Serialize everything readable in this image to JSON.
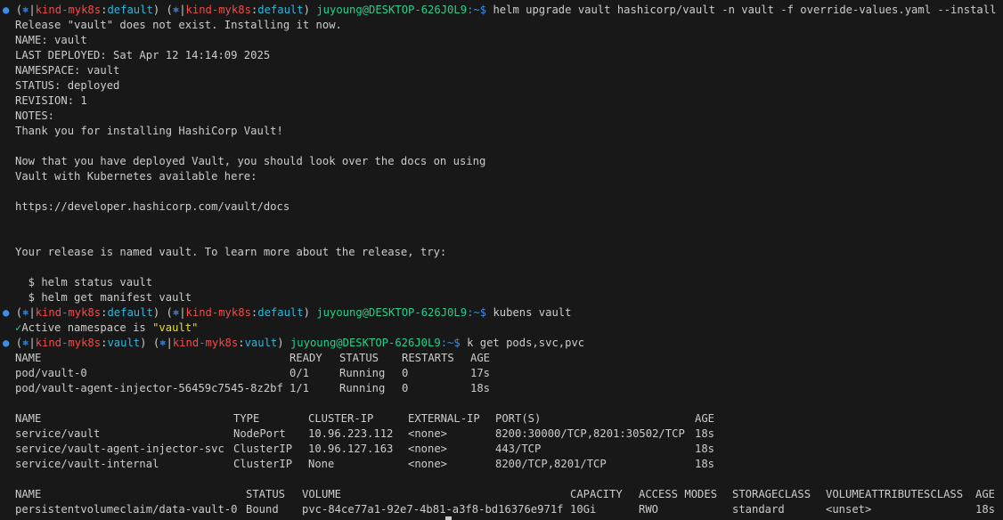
{
  "theme": {
    "background": "#181818",
    "text": "#cccccc",
    "red": "#f14c4c",
    "green": "#23d18b",
    "blue": "#3b8eea",
    "cyan": "#29b8db",
    "yellow": "#e5e510"
  },
  "prompts": [
    {
      "bullet": "●",
      "open": "(",
      "k8s_icon": "⎈",
      "sep": "|",
      "context": "kind-myk8s",
      "colon": ":",
      "namespace": "default",
      "close": ")",
      "user_host": "juyoung@DESKTOP-626J0L9",
      "dollar": ":~$",
      "command": "helm upgrade vault hashicorp/vault -n vault -f override-values.yaml --install"
    },
    {
      "bullet": "●",
      "open": "(",
      "k8s_icon": "⎈",
      "sep": "|",
      "context": "kind-myk8s",
      "colon": ":",
      "namespace": "default",
      "close": ")",
      "user_host": "juyoung@DESKTOP-626J0L9",
      "dollar": ":~$",
      "command": "kubens vault"
    },
    {
      "bullet": "●",
      "open": "(",
      "k8s_icon": "⎈",
      "sep": "|",
      "context": "kind-myk8s",
      "colon": ":",
      "namespace": "vault",
      "close": ")",
      "user_host": "juyoung@DESKTOP-626J0L9",
      "dollar": ":~$",
      "command": "k get pods,svc,pvc"
    }
  ],
  "helm_output": [
    "Release \"vault\" does not exist. Installing it now.",
    "NAME: vault",
    "LAST DEPLOYED: Sat Apr 12 14:14:09 2025",
    "NAMESPACE: vault",
    "STATUS: deployed",
    "REVISION: 1",
    "NOTES:",
    "Thank you for installing HashiCorp Vault!",
    "",
    "Now that you have deployed Vault, you should look over the docs on using",
    "Vault with Kubernetes available here:",
    "",
    "https://developer.hashicorp.com/vault/docs",
    "",
    "",
    "Your release is named vault. To learn more about the release, try:",
    "",
    "  $ helm status vault",
    "  $ helm get manifest vault"
  ],
  "kubens_output": {
    "check": "✓",
    "text_before": "Active namespace is ",
    "value": "\"vault\""
  },
  "pods": {
    "headers": [
      "NAME",
      "READY",
      "STATUS",
      "RESTARTS",
      "AGE"
    ],
    "rows": [
      [
        "pod/vault-0",
        "0/1",
        "Running",
        "0",
        "17s"
      ],
      [
        "pod/vault-agent-injector-56459c7545-8z2bf",
        "1/1",
        "Running",
        "0",
        "18s"
      ]
    ]
  },
  "services": {
    "headers": [
      "NAME",
      "TYPE",
      "CLUSTER-IP",
      "EXTERNAL-IP",
      "PORT(S)",
      "AGE"
    ],
    "rows": [
      [
        "service/vault",
        "NodePort",
        "10.96.223.112",
        "<none>",
        "8200:30000/TCP,8201:30502/TCP",
        "18s"
      ],
      [
        "service/vault-agent-injector-svc",
        "ClusterIP",
        "10.96.127.163",
        "<none>",
        "443/TCP",
        "18s"
      ],
      [
        "service/vault-internal",
        "ClusterIP",
        "None",
        "<none>",
        "8200/TCP,8201/TCP",
        "18s"
      ]
    ]
  },
  "pvcs": {
    "headers": [
      "NAME",
      "STATUS",
      "VOLUME",
      "CAPACITY",
      "ACCESS MODES",
      "STORAGECLASS",
      "VOLUMEATTRIBUTESCLASS",
      "AGE"
    ],
    "rows": [
      [
        "persistentvolumeclaim/data-vault-0",
        "Bound",
        "pvc-84ce77a1-92e7-4b81-a3f8-bd16376e971f",
        "10Gi",
        "RWO",
        "standard",
        "<unset>",
        "18s"
      ]
    ]
  }
}
